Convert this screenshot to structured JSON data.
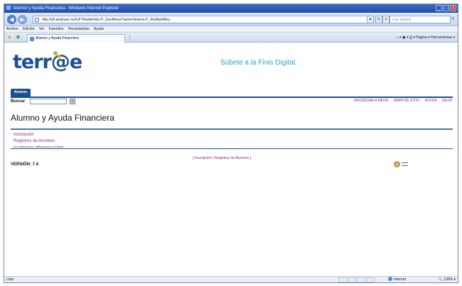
{
  "window": {
    "title": "Alumno y Ayuda Financiera - Windows Internet Explorer",
    "controls": [
      "_",
      "□",
      "X"
    ]
  },
  "addressbar": {
    "url": "http://uft.anahuac.mx/UFT/bwbkvtrbz.P_GenMenu?name=bmenu.P_StuMainMnu",
    "search_placeholder": "Live Search"
  },
  "menubar": {
    "items": [
      "Archivo",
      "Edición",
      "Ver",
      "Favoritos",
      "Herramientas",
      "Ayuda"
    ]
  },
  "tabbar": {
    "tab_label": "Alumno y Ayuda Financiera",
    "commands": "Página ▾  Herramientas ▾"
  },
  "page": {
    "logo_text": "terr@e",
    "slogan": "Súbete a la Finis Digital.",
    "portal_tab": "Alumno",
    "search_label": "Buscar",
    "top_links": [
      "REGRESAR A MENÚ",
      "MAPA DE SITIO",
      "AYUDA",
      "SALIR"
    ],
    "title": "Alumno y Ayuda Financiera",
    "menu": [
      {
        "label": "Inscripción"
      },
      {
        "label": "Registros de Alumnos",
        "description": "Ver retenciones, calificaciones y Kárdex"
      }
    ],
    "bottom_links": {
      "open": "[",
      "sep": "|",
      "close": "]",
      "links": [
        "Inscripción",
        "Registros de Alumnos"
      ]
    },
    "version": "VERSIÓN: 7.4"
  },
  "statusbar": {
    "text": "Listo",
    "zone": "Internet",
    "zoom": "100%"
  }
}
